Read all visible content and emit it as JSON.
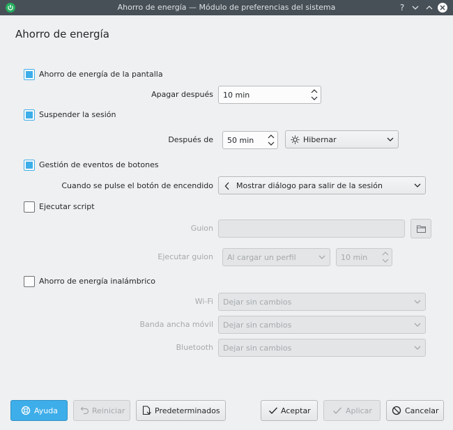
{
  "window": {
    "title": "Ahorro de energía — Módulo de preferencias del sistema",
    "help_glyph": "?"
  },
  "page": {
    "heading": "Ahorro de energía"
  },
  "screen_saving": {
    "checkbox_label": "Ahorro de energía de la pantalla",
    "checked": true,
    "off_after_label": "Apagar después",
    "off_after_value": "10 min"
  },
  "suspend": {
    "checkbox_label": "Suspender la sesión",
    "checked": true,
    "after_label": "Después de",
    "after_value": "50 min",
    "action_value": "Hibernar"
  },
  "buttons_events": {
    "checkbox_label": "Gestión de eventos de botones",
    "checked": true,
    "power_button_label": "Cuando se pulse el botón de encendido",
    "power_button_value": "Mostrar diálogo para salir de la sesión"
  },
  "script": {
    "checkbox_label": "Ejecutar script",
    "checked": false,
    "script_label": "Guion",
    "script_value": "",
    "run_label": "Ejecutar guion",
    "run_when_value": "Al cargar un perfil",
    "run_delay_value": "10 min"
  },
  "wireless": {
    "checkbox_label": "Ahorro de energía inalámbrico",
    "checked": false,
    "wifi_label": "Wi-Fi",
    "wifi_value": "Dejar sin cambios",
    "mobile_label": "Banda ancha móvil",
    "mobile_value": "Dejar sin cambios",
    "bluetooth_label": "Bluetooth",
    "bluetooth_value": "Dejar sin cambios"
  },
  "footer": {
    "help": "Ayuda",
    "reset": "Reiniciar",
    "defaults": "Predeterminados",
    "accept": "Aceptar",
    "apply": "Aplicar",
    "cancel": "Cancelar"
  },
  "colors": {
    "accent": "#3daee9",
    "titlebar": "#475057",
    "window_bg": "#eff0f1"
  }
}
